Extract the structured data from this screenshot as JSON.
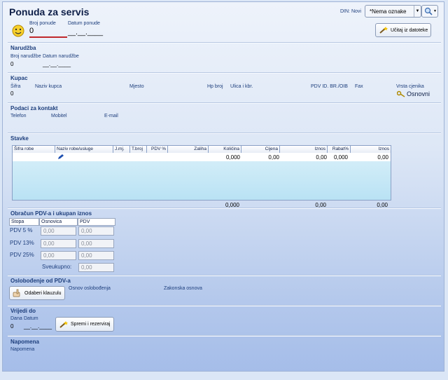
{
  "header": {
    "title": "Ponuda za servis",
    "din_label": "DIN: Novi",
    "tag_value": "*Nema oznake",
    "broj_ponude_label": "Broj ponude",
    "broj_ponude_value": "0",
    "datum_ponude_label": "Datum ponude",
    "datum_ponude_value": "__.__.____",
    "load_button_label": "Učitaj iz datoteke"
  },
  "narudzba": {
    "section": "Narudžba",
    "broj_label": "Broj narudžbe",
    "broj_value": "0",
    "datum_label": "Datum narudžbe",
    "datum_value": "__.__.____"
  },
  "kupac": {
    "section": "Kupac",
    "sifra_label": "Šifra",
    "sifra_value": "0",
    "naziv_label": "Naziv kupca",
    "mjesto_label": "Mjesto",
    "hp_label": "Hp broj",
    "ulica_label": "Ulica i kbr.",
    "pdv_label": "PDV ID. BR./OIB",
    "fax_label": "Fax",
    "cjenik_label": "Vrsta cjenika",
    "cjenik_value": "Osnovni"
  },
  "kontakt": {
    "section": "Podaci za kontakt",
    "telefon_label": "Telefon",
    "mobitel_label": "Mobitel",
    "email_label": "E-mail"
  },
  "stavke": {
    "section": "Stavke",
    "columns": [
      "Šifra robe",
      "Naziv robe/usluge",
      "J.mj.",
      "T.broj",
      "PDV %",
      "Zaliha",
      "Količina",
      "Cijena",
      "Iznos",
      "Rabat%",
      "Iznos"
    ],
    "row": {
      "kolicina": "0,000",
      "cijena": "0,00",
      "iznos": "0,00",
      "rabat": "0,000",
      "iznos2": "0,00"
    },
    "totals": {
      "kolicina": "0,000",
      "iznos": "0,00",
      "iznos2": "0,00"
    }
  },
  "pdv": {
    "section": "Obračun PDV-a i ukupan iznos",
    "col_stopa": "Stopa",
    "col_osnovica": "Osnovica",
    "col_pdv": "PDV",
    "rows": [
      {
        "stopa": "PDV 5 %",
        "osnovica": "0,00",
        "pdv": "0,00"
      },
      {
        "stopa": "PDV 13%",
        "osnovica": "0,00",
        "pdv": "0,00"
      },
      {
        "stopa": "PDV 25%",
        "osnovica": "0,00",
        "pdv": "0,00"
      }
    ],
    "sveukupno_label": "Sveukupno:",
    "sveukupno_value": "0,00"
  },
  "oslobodenje": {
    "section": "Oslobođenje od PDV-a",
    "button_label": "Odaberi klauzulu",
    "osnov_label": "Osnov oslobođenja",
    "zakonska_label": "Zakonska osnova"
  },
  "vrijedi": {
    "section": "Vrijedi do",
    "dana_label": "Dana",
    "dana_value": "0",
    "datum_label": "Datum",
    "datum_value": "__.__.____",
    "save_button_label": "Spremi i rezerviraj"
  },
  "napomena": {
    "section": "Napomena",
    "label": "Napomena"
  }
}
